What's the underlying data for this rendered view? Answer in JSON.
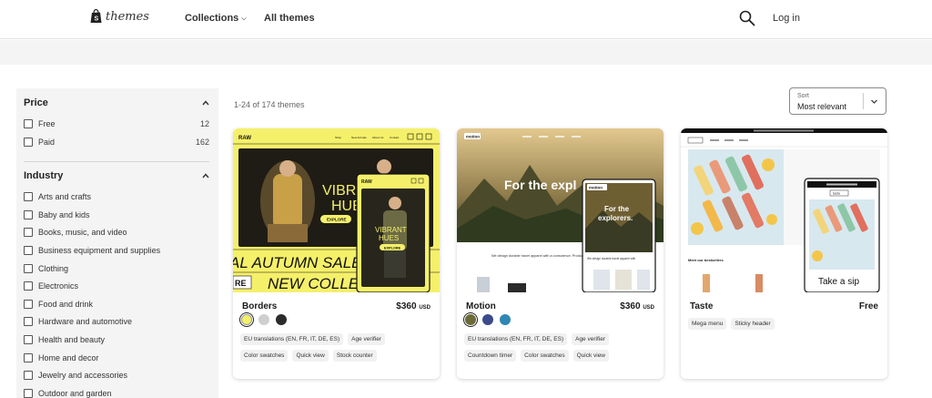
{
  "header": {
    "logo_text": "themes",
    "nav": {
      "collections": "Collections",
      "all_themes": "All themes"
    },
    "login": "Log in"
  },
  "filters": {
    "price": {
      "title": "Price",
      "options": [
        {
          "label": "Free",
          "count": "12"
        },
        {
          "label": "Paid",
          "count": "162"
        }
      ]
    },
    "industry": {
      "title": "Industry",
      "options": [
        "Arts and crafts",
        "Baby and kids",
        "Books, music, and video",
        "Business equipment and supplies",
        "Clothing",
        "Electronics",
        "Food and drink",
        "Hardware and automotive",
        "Health and beauty",
        "Home and decor",
        "Jewelry and accessories",
        "Outdoor and garden"
      ]
    }
  },
  "results": {
    "count_text": "1-24 of 174 themes",
    "sort_label": "Sort",
    "sort_value": "Most relevant"
  },
  "themes": [
    {
      "name": "Borders",
      "price": "$360",
      "currency": "USD",
      "swatches": [
        "#f5f06a",
        "#cfcfcf",
        "#2b2b2b"
      ],
      "tags": [
        "EU translations (EN, FR, IT, DE, ES)",
        "Age verifier",
        "Color swatches",
        "Quick view",
        "Stock counter"
      ],
      "preview": {
        "brand": "RAW",
        "nav": [
          "Shop",
          "New Arrivals",
          "About Us",
          "Contact"
        ],
        "headline_1": "VIBRANT",
        "headline_2": "HUES",
        "cta": "EXPLORE",
        "marquee_1": "AL AUTUMN SALE",
        "marquee_2": "NEW COLLEC",
        "marquee_prefix": "RE",
        "mobile_headline_1": "VIBRANT",
        "mobile_headline_2": "HUES",
        "mobile_cta": "EXPLORE"
      }
    },
    {
      "name": "Motion",
      "price": "$360",
      "currency": "USD",
      "swatches": [
        "#6b6b3a",
        "#3c4a8c",
        "#2f87b5"
      ],
      "tags": [
        "EU translations (EN, FR, IT, DE, ES)",
        "Age verifier",
        "Countdown timer",
        "Color swatches",
        "Quick view"
      ],
      "preview": {
        "brand": "motion",
        "headline": "For the expl",
        "mobile_headline_1": "For the",
        "mobile_headline_2": "explorers.",
        "body": "We design durable travel apparel with a conscience. Products by United By Blue. Video by",
        "mobile_body": "We design durable travel apparel with"
      }
    },
    {
      "name": "Taste",
      "price": "Free",
      "currency": "",
      "swatches": [],
      "tags": [
        "Mega menu",
        "Sticky header"
      ],
      "preview": {
        "brand": "taste",
        "bestsellers": "Meet our bestsellers",
        "mobile_headline": "Take a sip"
      }
    }
  ],
  "colors": {
    "accent_yellow": "#f5f06a",
    "sidebar_bg": "#f4f4f4"
  }
}
